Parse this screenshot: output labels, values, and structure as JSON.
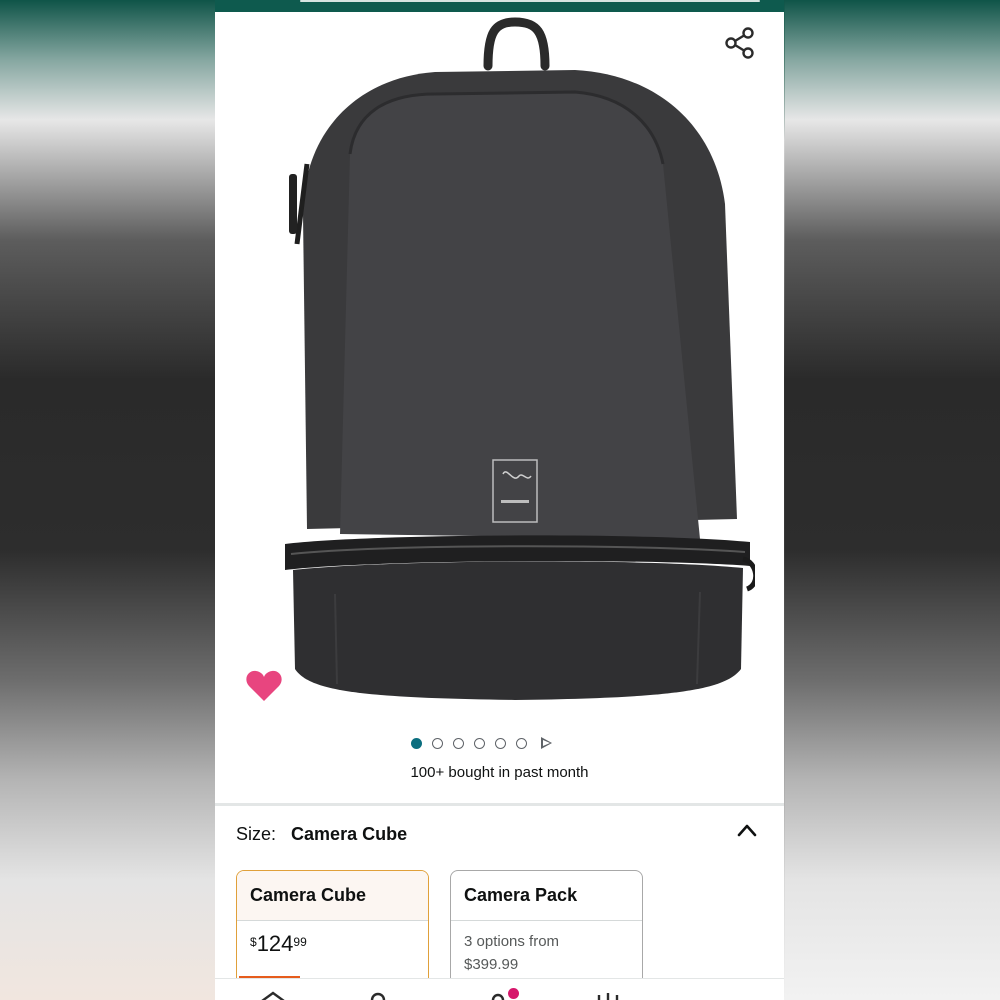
{
  "gallery": {
    "image_alt": "Black camera backpack",
    "dots_total": 6,
    "active_dot": 1,
    "has_video": true
  },
  "social_proof": "100+ bought in past month",
  "size": {
    "label": "Size:",
    "selected": "Camera Cube"
  },
  "options": [
    {
      "name": "Camera Cube",
      "currency": "$",
      "price_whole": "124",
      "price_fraction": "99",
      "selected": true
    },
    {
      "name": "Camera Pack",
      "line1": "3 options from",
      "line2": "$399.99",
      "selected": false
    }
  ],
  "colors": {
    "accent_teal": "#0b6e7f",
    "heart_pink": "#e8457f",
    "header_green": "#0e5a4e",
    "selected_border": "#e0a03a",
    "deal_orange": "#e65c1c"
  },
  "icons": [
    "share-icon",
    "heart-icon",
    "chevron-up-icon",
    "play-icon"
  ]
}
